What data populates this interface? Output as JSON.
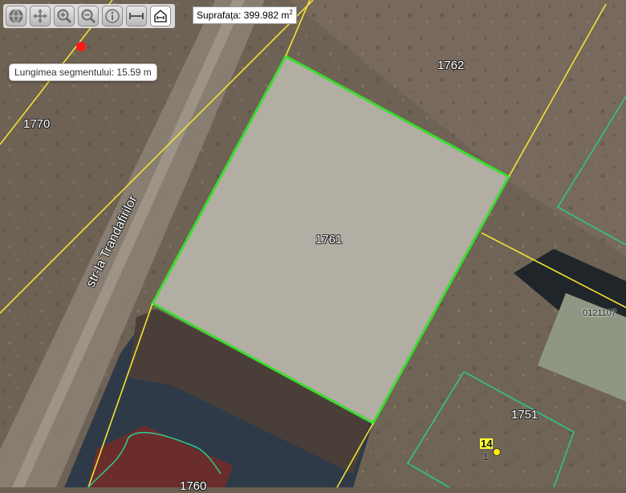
{
  "toolbar": {
    "tools": [
      {
        "icon": "globe-icon"
      },
      {
        "icon": "pan-arrows-icon"
      },
      {
        "icon": "zoom-in-icon"
      },
      {
        "icon": "zoom-out-icon"
      },
      {
        "icon": "info-icon"
      },
      {
        "icon": "measure-distance-icon"
      },
      {
        "icon": "measure-area-icon"
      }
    ]
  },
  "measurement": {
    "area_label": "Suprafața: 399.982 m",
    "area_unit_exponent": "2",
    "segment_label": "Lungimea segmentului: 15.59 m"
  },
  "map": {
    "street_name": "str-la Trandafirilor",
    "parcels": {
      "p1762": "1762",
      "p1770": "1770",
      "p1761": "1761",
      "p1751": "1751",
      "p0121107": "0121107",
      "p1760": "1760"
    },
    "marker": {
      "label": "14",
      "sublabel": "1"
    },
    "colors": {
      "selected_outline": "#3bdc2e",
      "boundary_line": "#f2e233",
      "cadastral_line": "#2fc48c",
      "marker_point": "#ff1a1a",
      "marker_dot": "#ffee00"
    }
  }
}
